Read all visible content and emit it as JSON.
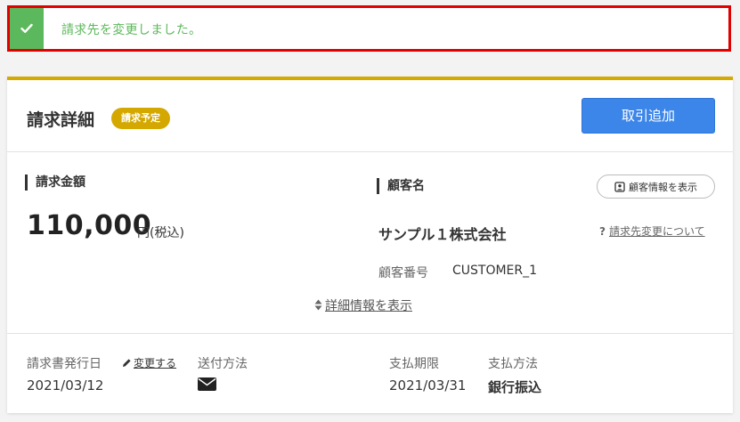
{
  "alert": {
    "message": "請求先を変更しました。",
    "icon": "check-icon",
    "color_success": "#5cb85c",
    "border_color": "#e00000"
  },
  "card": {
    "title": "請求詳細",
    "status_badge": "請求予定",
    "add_transaction_button": "取引追加",
    "accent_color": "#d4aa00",
    "primary_color": "#3c86ea"
  },
  "billing": {
    "amount_label": "請求金額",
    "amount": "110,000",
    "amount_unit": "円(税込)"
  },
  "customer": {
    "label": "顧客名",
    "show_info_button": "顧客情報を表示",
    "name": "サンプル１株式会社",
    "change_help_link": "請求先変更について",
    "number_label": "顧客番号",
    "number_value": "CUSTOMER_1"
  },
  "details_toggle": "詳細情報を表示",
  "footer": {
    "issue_date_label": "請求書発行日",
    "change_link": "変更する",
    "issue_date_value": "2021/03/12",
    "send_method_label": "送付方法",
    "send_method_icon": "envelope-icon",
    "due_date_label": "支払期限",
    "due_date_value": "2021/03/31",
    "payment_method_label": "支払方法",
    "payment_method_value": "銀行振込"
  }
}
